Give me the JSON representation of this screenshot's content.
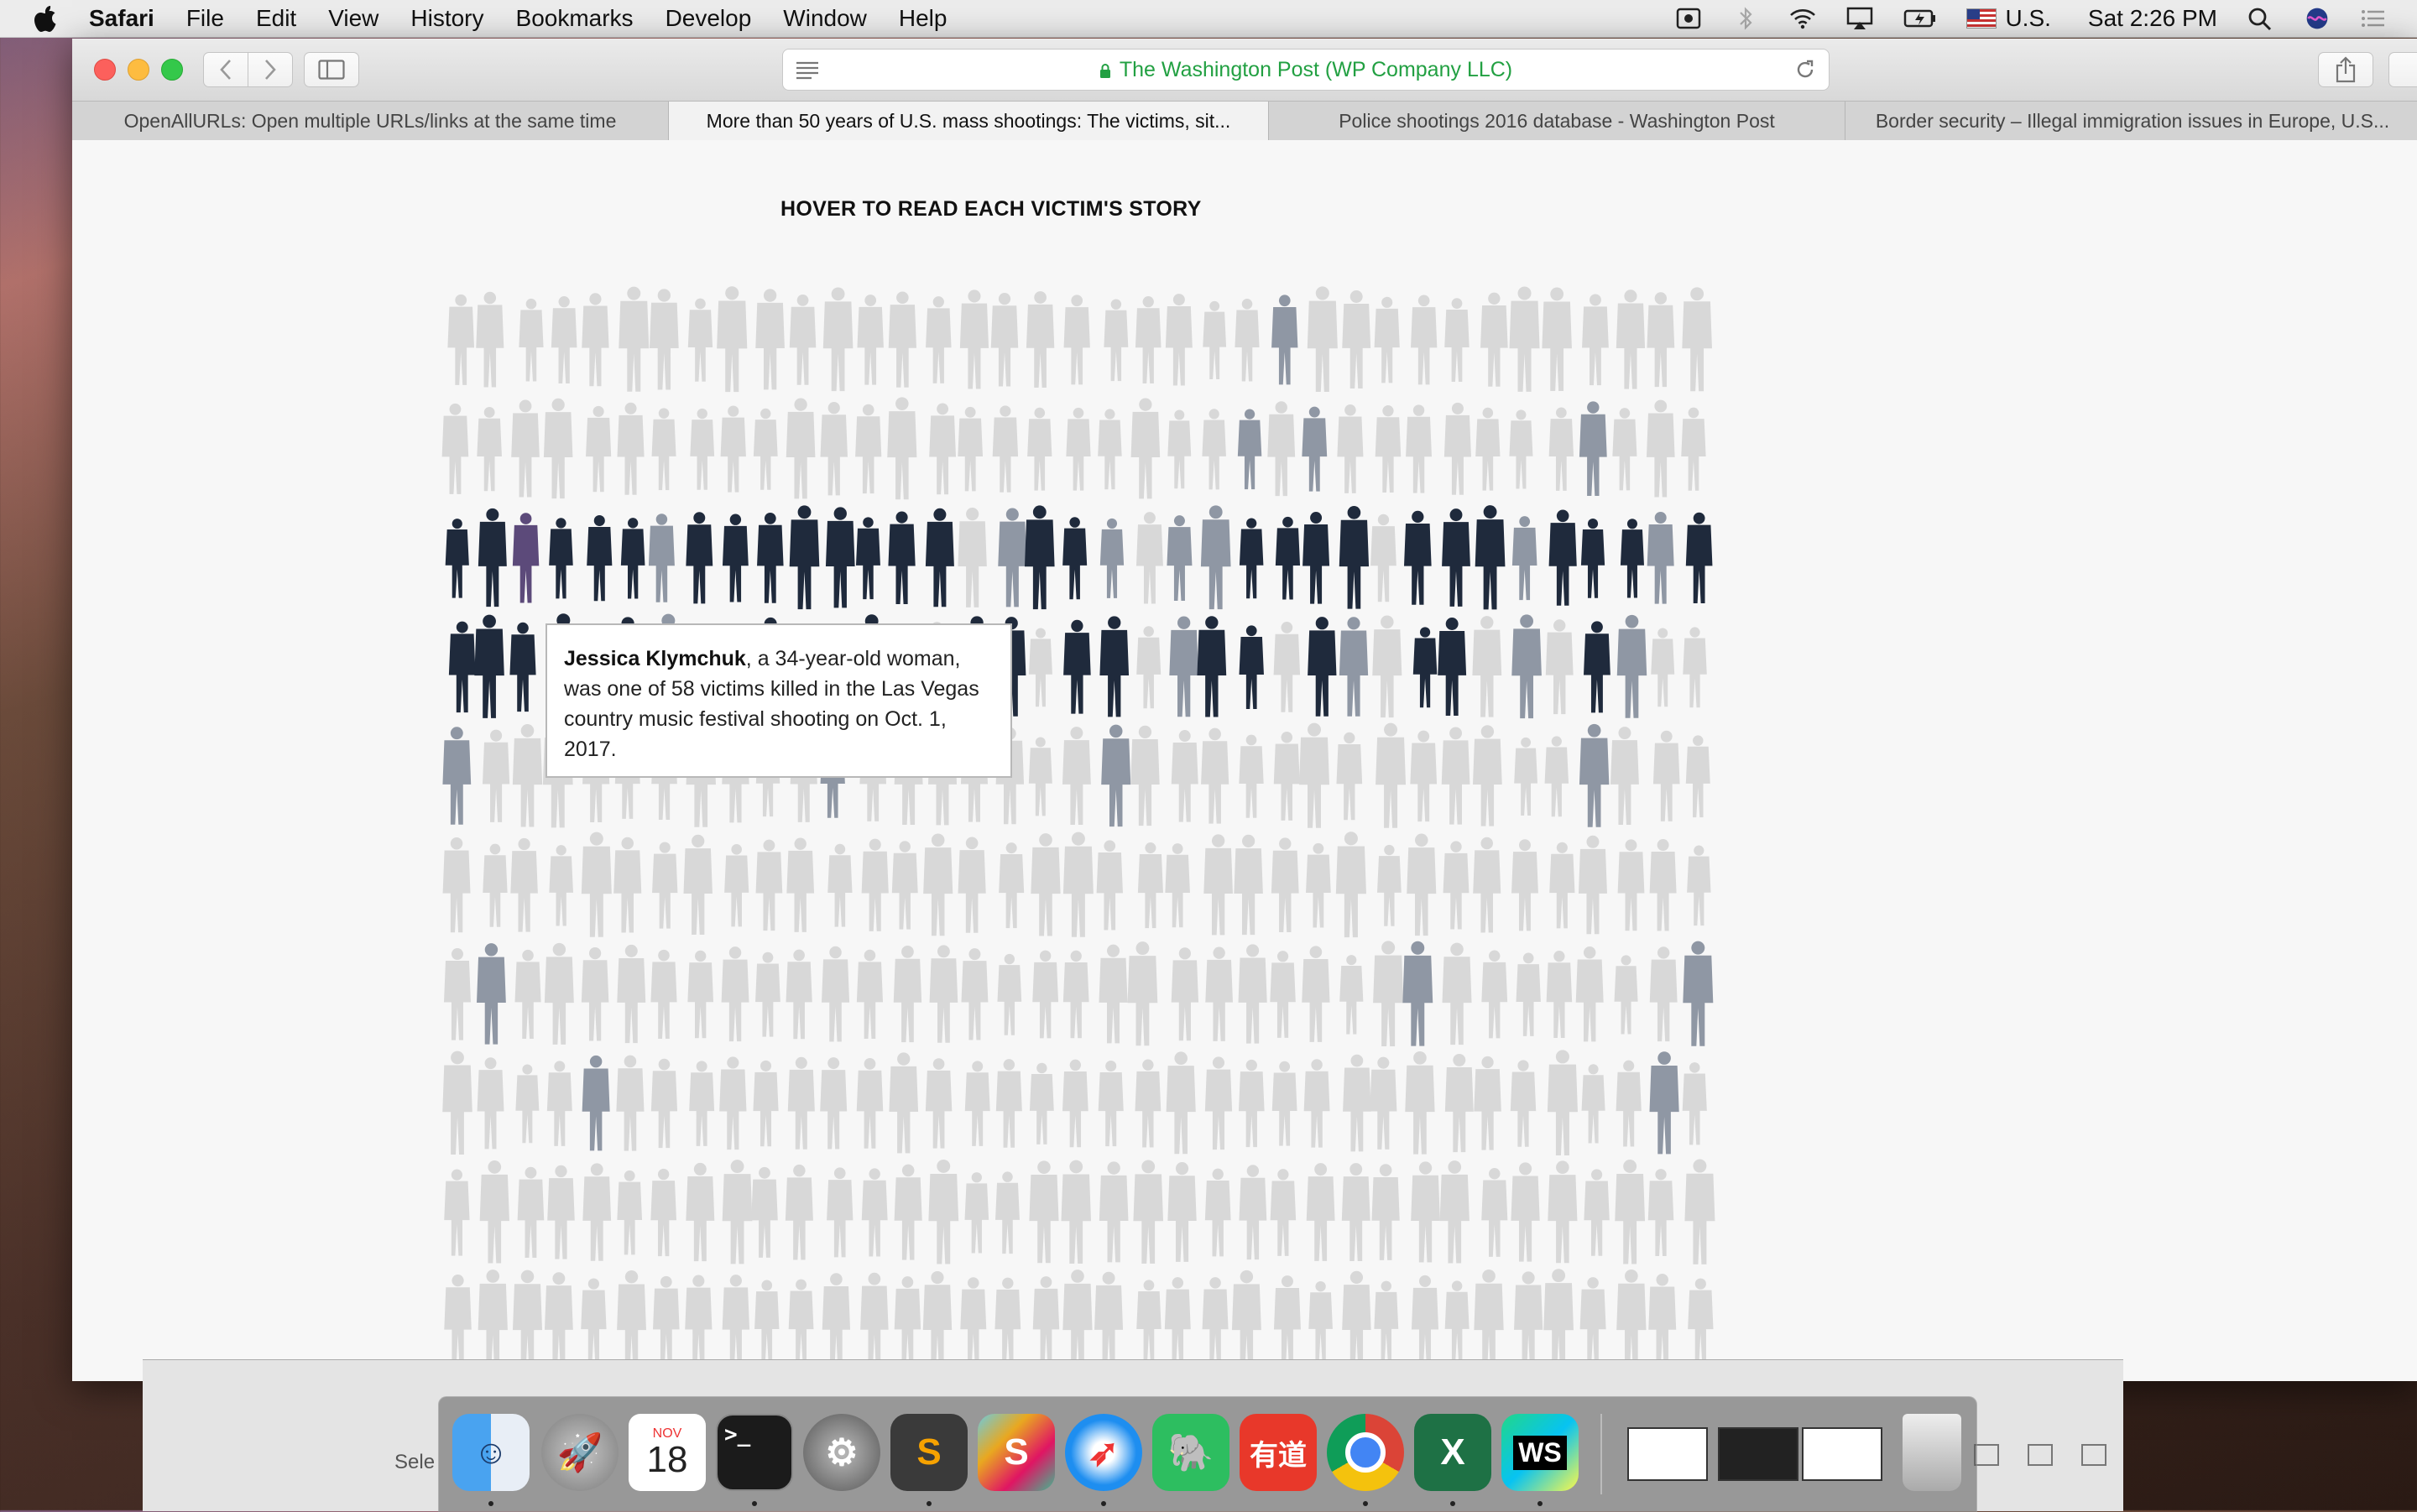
{
  "menubar": {
    "app_name": "Safari",
    "items": [
      "File",
      "Edit",
      "View",
      "History",
      "Bookmarks",
      "Develop",
      "Window",
      "Help"
    ],
    "input_source": "U.S.",
    "clock": "Sat 2:26 PM"
  },
  "toolbar": {
    "address": "The Washington Post (WP Company LLC)"
  },
  "tabs": [
    "OpenAllURLs: Open multiple URLs/links at the same time",
    "More than 50 years of U.S. mass shootings: The victims, sit...",
    "Police shootings 2016 database - Washington Post",
    "Border security – Illegal immigration issues in Europe, U.S..."
  ],
  "page": {
    "heading": "HOVER TO READ EACH VICTIM'S STORY",
    "tooltip": {
      "name": "Jessica Klymchuk",
      "text": ", a 34-year-old woman, was one of 58 victims killed in the Las Vegas country music festival shooting on Oct. 1, 2017."
    },
    "colors": {
      "highlight_dark": "#1f2a3c",
      "secondary": "#8f97a4",
      "faded": "#d8d8d8",
      "selected": "#5c4a7a"
    }
  },
  "background_window": {
    "label": "Sele"
  },
  "dock": {
    "calendar_month": "NOV",
    "calendar_day": "18",
    "items": [
      "finder-icon",
      "launchpad-icon",
      "calendar-icon",
      "terminal-icon",
      "system-preferences-icon",
      "sublime-text-icon",
      "slack-icon",
      "safari-icon",
      "evernote-icon",
      "youdao-icon",
      "chrome-icon",
      "excel-icon",
      "webstorm-icon"
    ]
  }
}
